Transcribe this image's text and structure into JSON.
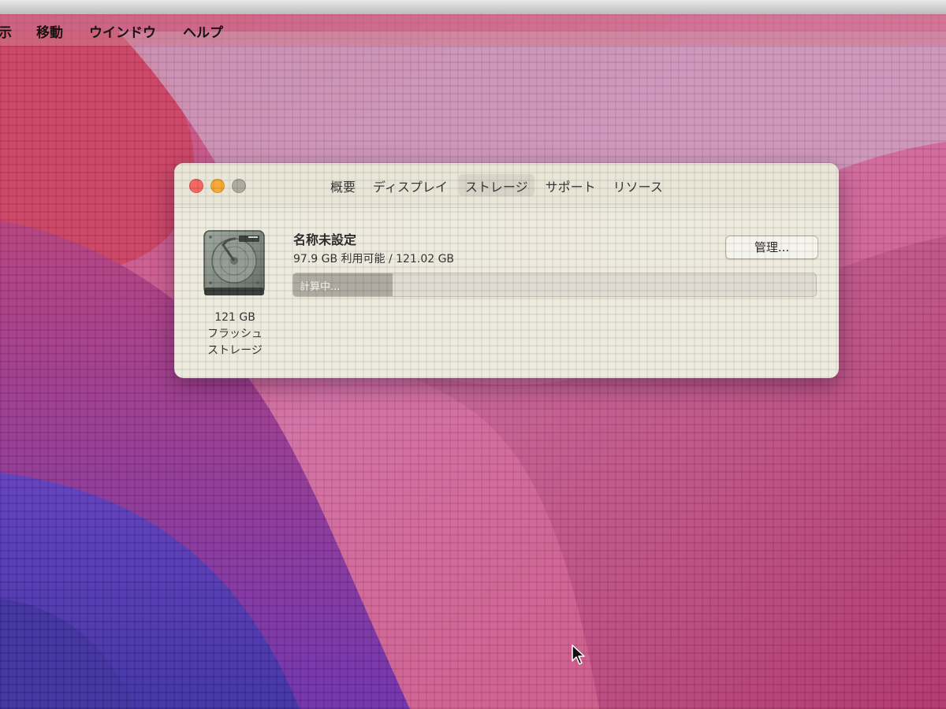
{
  "menubar": {
    "items": [
      "示",
      "移動",
      "ウインドウ",
      "ヘルプ"
    ]
  },
  "window": {
    "tabs": [
      {
        "label": "概要",
        "active": false
      },
      {
        "label": "ディスプレイ",
        "active": false
      },
      {
        "label": "ストレージ",
        "active": true
      },
      {
        "label": "サポート",
        "active": false
      },
      {
        "label": "リソース",
        "active": false
      }
    ],
    "disk": {
      "icon": "hard-drive-icon",
      "capacity": "121 GB",
      "type_line1": "フラッシュ",
      "type_line2": "ストレージ"
    },
    "volume": {
      "name": "名称未設定",
      "info": "97.9 GB 利用可能 / 121.02 GB"
    },
    "manage_label": "管理...",
    "storage_bar": {
      "label": "計算中...",
      "fill_fraction": 0.19
    }
  },
  "colors": {
    "close": "#f25f58",
    "minimize": "#f4a52c",
    "zoom_inactive": "#a8a59a",
    "wallpaper_magenta": "#b0287a",
    "wallpaper_purple": "#5a2ab0"
  }
}
